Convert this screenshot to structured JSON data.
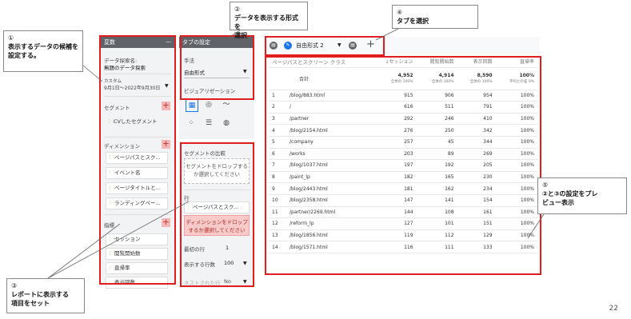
{
  "callouts": {
    "c1": {
      "num": "①",
      "text1": "表示するデータの候補を",
      "text2": "設定する。"
    },
    "c2": {
      "num": "②",
      "text1": "データを表示する形式を",
      "text2": "選択"
    },
    "c3": {
      "num": "③",
      "text1": "レポートに表示する",
      "text2": "項目をセット"
    },
    "c4": {
      "num": "④",
      "text1": "タブを選択"
    },
    "c5": {
      "num": "⑤",
      "text1": "②と③の設定をプレ",
      "text2": "ビュー表示"
    }
  },
  "variables": {
    "header": "変数",
    "explore_name_label": "データ探索名:",
    "explore_name": "無題のデータ探索",
    "date_label": "カスタム",
    "date_value": "9月1日～2022年9月30日",
    "segment_label": "セグメント",
    "segments": [
      "CVしたセグメント"
    ],
    "dimension_label": "ディメンション",
    "dimensions": [
      "ページパスとスク...",
      "イベント名",
      "ページタイトルと...",
      "ランディングペー..."
    ],
    "metrics_label": "指標",
    "metrics": [
      "セッション",
      "閲覧開始数",
      "直帰率",
      "表示回数"
    ]
  },
  "tab_settings": {
    "header": "タブの設定",
    "method_label": "手法",
    "method_value": "自由形式",
    "viz_label": "ビジュアリゼーション",
    "segment_compare_label": "セグメントの比較",
    "segment_drop": "セグメントをドロップするか選択してください",
    "rows_label": "行",
    "row_item": "ページパスとスク...",
    "dimension_drop": "ディメンションをドロップするか選択してください",
    "first_row_label": "最初の行",
    "first_row_value": "1",
    "show_rows_label": "表示する行数",
    "show_rows_value": "100",
    "nested_label": "ネストされた行",
    "nested_value": "No"
  },
  "tabs": {
    "active_tab": "自由形式 2",
    "add": "+"
  },
  "table": {
    "headers": [
      "ページパスとスクリーン クラス",
      "↓セッション",
      "閲覧開始数",
      "表示回数",
      "直帰率"
    ],
    "total_label": "合計",
    "totals": [
      "4,952",
      "4,914",
      "8,590",
      "100%"
    ],
    "totals_sub": [
      "全体の 100%",
      "全体の 100%",
      "全体の 100%",
      "平均との差 0%"
    ],
    "rows": [
      [
        "1",
        "/blog/883.html",
        "915",
        "906",
        "954",
        "100%"
      ],
      [
        "2",
        "/",
        "616",
        "511",
        "791",
        "100%"
      ],
      [
        "3",
        "/partner",
        "292",
        "246",
        "410",
        "100%"
      ],
      [
        "4",
        "/blog/2154.html",
        "276",
        "250",
        "342",
        "100%"
      ],
      [
        "5",
        "/company",
        "257",
        "45",
        "344",
        "100%"
      ],
      [
        "6",
        "/works",
        "203",
        "89",
        "269",
        "100%"
      ],
      [
        "7",
        "/blog/1037.html",
        "197",
        "192",
        "205",
        "100%"
      ],
      [
        "8",
        "/paint_lp",
        "182",
        "165",
        "230",
        "100%"
      ],
      [
        "9",
        "/blog/2443.html",
        "181",
        "162",
        "234",
        "100%"
      ],
      [
        "10",
        "/blog/2358.html",
        "147",
        "141",
        "154",
        "100%"
      ],
      [
        "11",
        "/partner/2269.html",
        "144",
        "108",
        "161",
        "100%"
      ],
      [
        "12",
        "/reform_lp",
        "127",
        "101",
        "151",
        "100%"
      ],
      [
        "13",
        "/blog/1856.html",
        "119",
        "112",
        "129",
        "100%"
      ],
      [
        "14",
        "/blog/1571.html",
        "116",
        "111",
        "133",
        "100%"
      ]
    ]
  },
  "page_number": "22",
  "colors": {
    "accent_red": "#e21d1d",
    "panel_head": "#5f6368",
    "tab_blue": "#1a73e8"
  }
}
